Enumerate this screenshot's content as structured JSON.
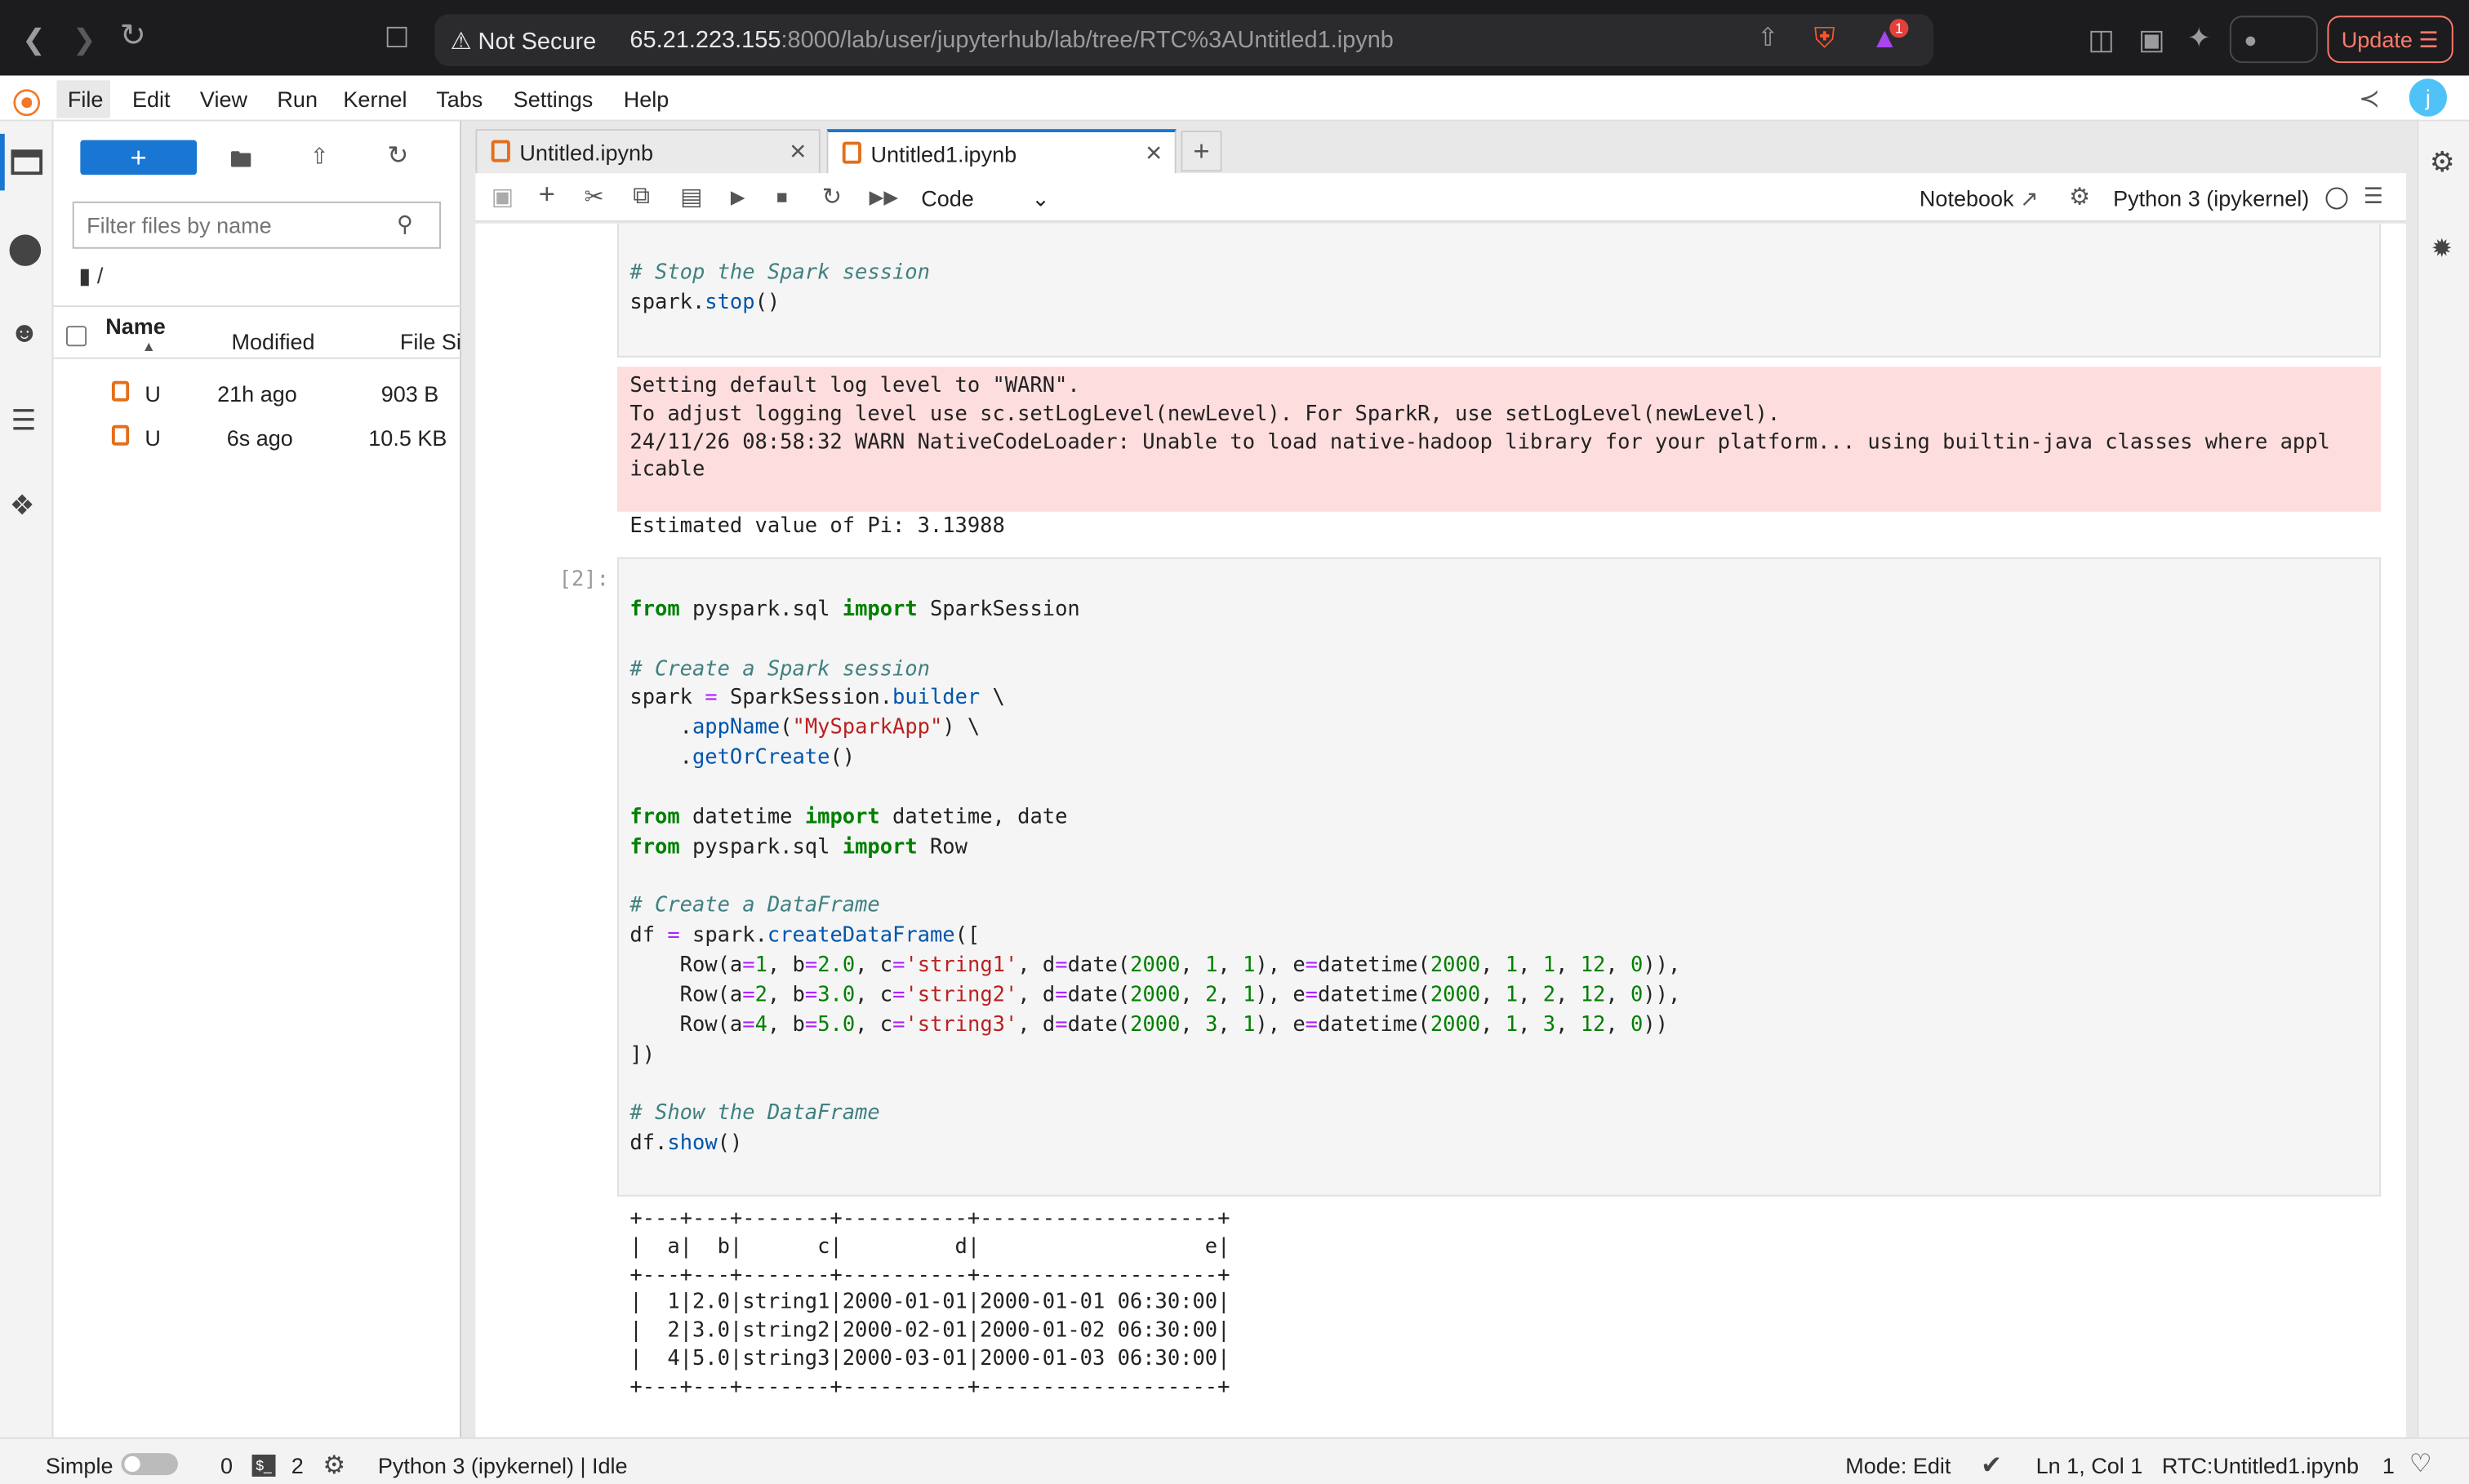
{
  "browser": {
    "security_label": "Not Secure",
    "url_host": "65.21.223.155",
    "url_rest": ":8000/lab/user/jupyterhub/lab/tree/RTC%3AUntitled1.ipynb",
    "vpn_label": "VPN",
    "update_label": "Update",
    "badge_count": "1"
  },
  "menu": {
    "items": [
      "File",
      "Edit",
      "View",
      "Run",
      "Kernel",
      "Tabs",
      "Settings",
      "Help"
    ]
  },
  "filebrowser": {
    "new_label": "+",
    "filter_placeholder": "Filter files by name",
    "breadcrumb": "/",
    "columns": {
      "name": "Name",
      "modified": "Modified",
      "size": "File Si"
    },
    "files": [
      {
        "name": "U",
        "modified": "21h ago",
        "size": "903 B"
      },
      {
        "name": "U",
        "modified": "6s ago",
        "size": "10.5 KB"
      }
    ]
  },
  "tabs": [
    {
      "label": "Untitled.ipynb"
    },
    {
      "label": "Untitled1.ipynb"
    }
  ],
  "toolbar": {
    "cell_type": "Code",
    "notebook_label": "Notebook",
    "kernel_label": "Python 3 (ipykernel)"
  },
  "cell1": {
    "code_lines": [
      "# Stop the Spark session",
      "spark.stop()"
    ],
    "stderr_lines": [
      "Setting default log level to \"WARN\".",
      "To adjust logging level use sc.setLogLevel(newLevel). For SparkR, use setLogLevel(newLevel).",
      "24/11/26 08:58:32 WARN NativeCodeLoader: Unable to load native-hadoop library for your platform... using builtin-java classes where appl",
      "icable"
    ],
    "stdout": "Estimated value of Pi: 3.13988"
  },
  "cell2": {
    "prompt": "[2]:",
    "code_lines": [
      "",
      "from pyspark.sql import SparkSession",
      "",
      "# Create a Spark session",
      "spark = SparkSession.builder \\",
      "    .appName(\"MySparkApp\") \\",
      "    .getOrCreate()",
      "",
      "from datetime import datetime, date",
      "from pyspark.sql import Row",
      "",
      "# Create a DataFrame",
      "df = spark.createDataFrame([",
      "    Row(a=1, b=2.0, c='string1', d=date(2000, 1, 1), e=datetime(2000, 1, 1, 12, 0)),",
      "    Row(a=2, b=3.0, c='string2', d=date(2000, 2, 1), e=datetime(2000, 1, 2, 12, 0)),",
      "    Row(a=4, b=5.0, c='string3', d=date(2000, 3, 1), e=datetime(2000, 1, 3, 12, 0))",
      "])",
      "",
      "# Show the DataFrame",
      "df.show()"
    ],
    "output_lines": [
      "+---+---+-------+----------+-------------------+",
      "|  a|  b|      c|         d|                  e|",
      "+---+---+-------+----------+-------------------+",
      "|  1|2.0|string1|2000-01-01|2000-01-01 06:30:00|",
      "|  2|3.0|string2|2000-02-01|2000-01-02 06:30:00|",
      "|  4|5.0|string3|2000-03-01|2000-01-03 06:30:00|",
      "+---+---+-------+----------+-------------------+"
    ]
  },
  "statusbar": {
    "mode_toggle_label": "Simple",
    "terminals_count": "0",
    "kernels_count": "2",
    "kernel_status": "Python 3 (ipykernel) | Idle",
    "edit_mode": "Mode: Edit",
    "cursor_pos": "Ln 1, Col 1",
    "doc_name": "RTC:Untitled1.ipynb",
    "notif_count": "1"
  },
  "user": {
    "initial": "j"
  }
}
